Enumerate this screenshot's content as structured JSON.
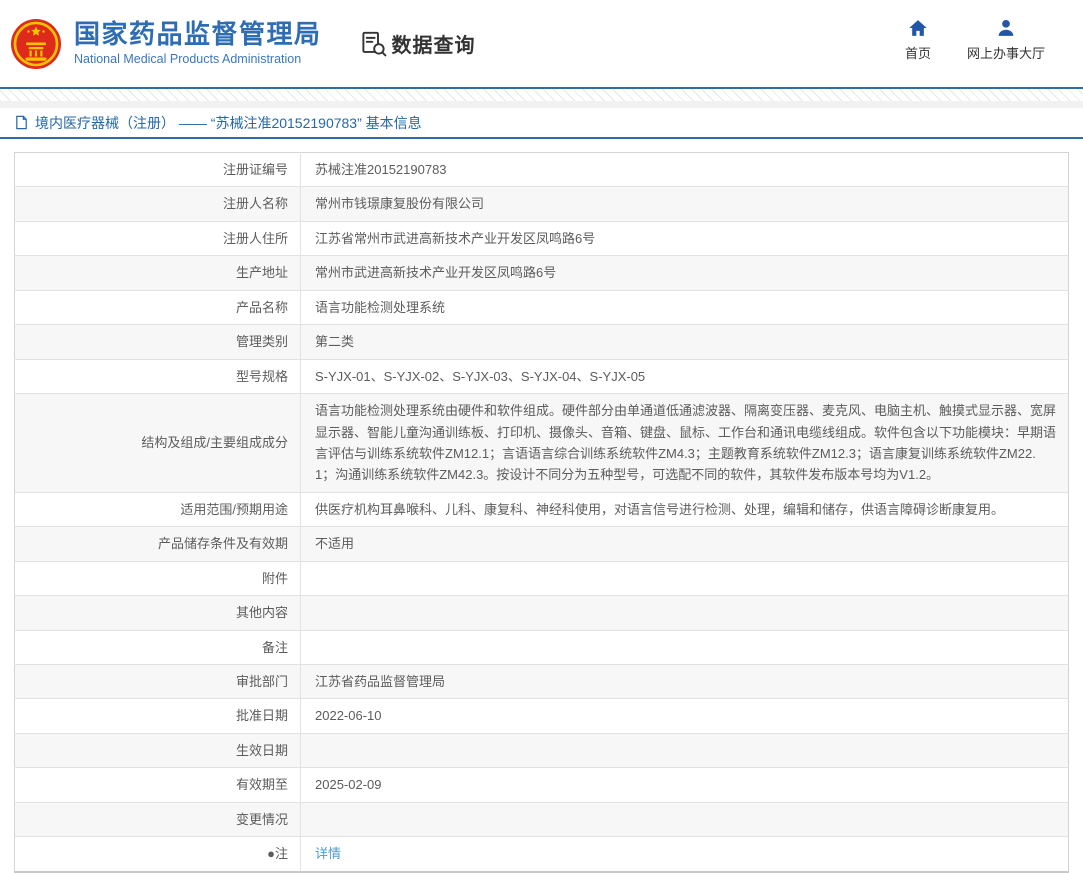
{
  "header": {
    "site_title": "国家药品监督管理局",
    "site_subtitle": "National Medical Products Administration",
    "section_title": "数据查询",
    "nav": [
      {
        "label": "首页",
        "icon": "home-icon"
      },
      {
        "label": "网上办事大厅",
        "icon": "user-icon"
      }
    ]
  },
  "icons": {
    "emblem": "national-emblem-icon",
    "query": "document-search-icon",
    "breadcrumb": "page-icon"
  },
  "colors": {
    "brand_blue": "#2e6db4",
    "nav_icon_blue": "#2257a8",
    "breadcrumb_blue": "#2368a8",
    "divider_blue": "#2e6da4",
    "link_blue": "#4a9bd5",
    "row_alt_gray": "#f7f7f7"
  },
  "breadcrumb": {
    "text": "境内医疗器械（注册） —— “苏械注准20152190783” 基本信息"
  },
  "table": {
    "rows": [
      {
        "label": "注册证编号",
        "value": "苏械注准20152190783"
      },
      {
        "label": "注册人名称",
        "value": "常州市钱璟康复股份有限公司"
      },
      {
        "label": "注册人住所",
        "value": "江苏省常州市武进高新技术产业开发区凤鸣路6号"
      },
      {
        "label": "生产地址",
        "value": "常州市武进高新技术产业开发区凤鸣路6号"
      },
      {
        "label": "产品名称",
        "value": "语言功能检测处理系统"
      },
      {
        "label": "管理类别",
        "value": "第二类"
      },
      {
        "label": "型号规格",
        "value": "S-YJX-01、S-YJX-02、S-YJX-03、S-YJX-04、S-YJX-05"
      },
      {
        "label": "结构及组成/主要组成成分",
        "value": "语言功能检测处理系统由硬件和软件组成。硬件部分由单通道低通滤波器、隔离变压器、麦克风、电脑主机、触摸式显示器、宽屏显示器、智能儿童沟通训练板、打印机、摄像头、音箱、键盘、鼠标、工作台和通讯电缆线组成。软件包含以下功能模块：早期语言评估与训练系统软件ZM12.1；言语语言综合训练系统软件ZM4.3；主题教育系统软件ZM12.3；语言康复训练系统软件ZM22.1；沟通训练系统软件ZM42.3。按设计不同分为五种型号，可选配不同的软件，其软件发布版本号均为V1.2。"
      },
      {
        "label": "适用范围/预期用途",
        "value": "供医疗机构耳鼻喉科、儿科、康复科、神经科使用，对语言信号进行检测、处理，编辑和储存，供语言障碍诊断康复用。"
      },
      {
        "label": "产品储存条件及有效期",
        "value": "不适用"
      },
      {
        "label": "附件",
        "value": ""
      },
      {
        "label": "其他内容",
        "value": ""
      },
      {
        "label": "备注",
        "value": ""
      },
      {
        "label": "审批部门",
        "value": "江苏省药品监督管理局"
      },
      {
        "label": "批准日期",
        "value": "2022-06-10"
      },
      {
        "label": "生效日期",
        "value": ""
      },
      {
        "label": "有效期至",
        "value": "2025-02-09"
      },
      {
        "label": "变更情况",
        "value": ""
      },
      {
        "label": "●注",
        "value": "详情",
        "is_link": true
      }
    ]
  }
}
